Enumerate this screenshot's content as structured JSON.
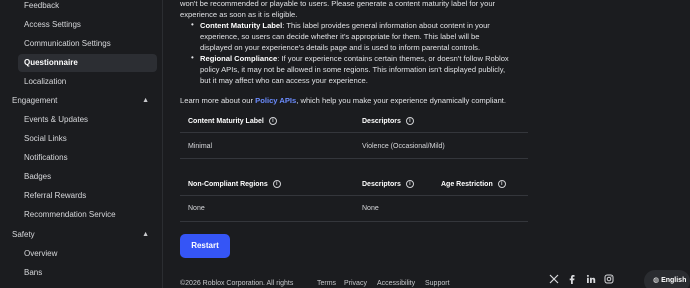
{
  "sidebar": {
    "items_top": [
      {
        "label": "Feedback"
      },
      {
        "label": "Access Settings"
      },
      {
        "label": "Communication Settings"
      },
      {
        "label": "Questionnaire",
        "active": true
      },
      {
        "label": "Localization"
      }
    ],
    "engagement": {
      "label": "Engagement",
      "items": [
        {
          "label": "Events & Updates"
        },
        {
          "label": "Social Links"
        },
        {
          "label": "Notifications"
        },
        {
          "label": "Badges"
        },
        {
          "label": "Referral Rewards"
        },
        {
          "label": "Recommendation Service"
        }
      ]
    },
    "safety": {
      "label": "Safety",
      "items": [
        {
          "label": "Overview"
        },
        {
          "label": "Bans"
        }
      ]
    }
  },
  "main": {
    "intro_line1": "won't be recommended or playable to users. Please generate a content maturity label for your",
    "intro_line2": "experience as soon as it is eligible.",
    "bullet1_title": "Content Maturity Label",
    "bullet1_line1": ": This label provides general information about content in your",
    "bullet1_line2": "experience, so users can decide whether it's appropriate for them. This label will be",
    "bullet1_line3": "displayed on your experience's details page and is used to inform parental controls.",
    "bullet2_title": "Regional Compliance",
    "bullet2_line1": ": If your experience contains certain themes, or doesn't follow Roblox",
    "bullet2_line2": "policy APIs, it may not be allowed in some regions. This information isn't displayed publicly,",
    "bullet2_line3": "but it may affect who can access your experience.",
    "learn_prefix": "Learn more about our ",
    "learn_link": "Policy APIs",
    "learn_suffix": ", which help you make your experience dynamically compliant.",
    "table1": {
      "headers": [
        "Content Maturity Label",
        "Descriptors"
      ],
      "row": [
        "Minimal",
        "Violence (Occasional/Mild)"
      ]
    },
    "table2": {
      "headers": [
        "Non-Compliant Regions",
        "Descriptors",
        "Age Restriction"
      ],
      "row": [
        "None",
        "None"
      ]
    },
    "restart_label": "Restart"
  },
  "footer": {
    "copyright": "©2026 Roblox Corporation. All rights",
    "links": [
      "Terms",
      "Privacy",
      "Accessibility",
      "Support"
    ],
    "language": "English"
  }
}
